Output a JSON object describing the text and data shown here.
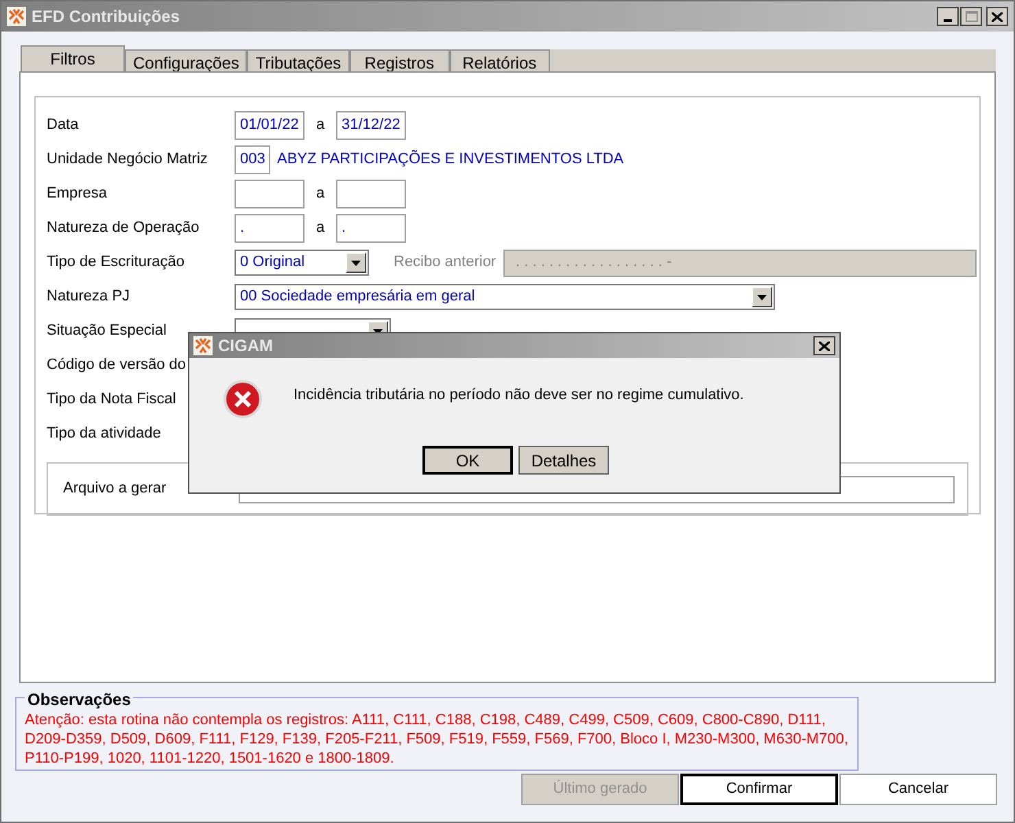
{
  "window": {
    "title": "EFD Contribuições"
  },
  "tabs": [
    {
      "label": "Filtros",
      "selected": true
    },
    {
      "label": "Configurações",
      "selected": false
    },
    {
      "label": "Tributações",
      "selected": false
    },
    {
      "label": "Registros",
      "selected": false
    },
    {
      "label": "Relatórios",
      "selected": false
    }
  ],
  "filters": [
    {
      "kind": "range",
      "label": "Data",
      "from": "01/01/22",
      "separator": "a",
      "to": "31/12/22"
    },
    {
      "kind": "code",
      "label": "Unidade Negócio Matriz",
      "code": "003",
      "description": "ABYZ PARTICIPAÇÕES E INVESTIMENTOS LTDA"
    },
    {
      "kind": "range",
      "label": "Empresa",
      "separator": "a"
    },
    {
      "kind": "range",
      "label": "Natureza de Operação",
      "from": ".",
      "separator": "a",
      "to": "."
    },
    {
      "kind": "combo_field",
      "label": "Tipo de Escrituração",
      "value": "0 Original",
      "field_label": "Recibo anterior",
      "field_value": ". . . . . . . . . . . . . . . . . . -"
    },
    {
      "kind": "combo_wide",
      "label": "Natureza PJ",
      "value": "00 Sociedade empresária em geral"
    },
    {
      "kind": "combo",
      "label": "Situação Especial"
    },
    {
      "kind": "label",
      "label": "Código de versão do"
    },
    {
      "kind": "label",
      "label": "Tipo da Nota Fiscal"
    },
    {
      "kind": "label",
      "label": "Tipo da atividade"
    }
  ],
  "output": {
    "label": "Arquivo a gerar"
  },
  "observations": {
    "title": "Observações",
    "text": "Atenção: esta rotina não contempla os registros: A111, C111, C188, C198, C489, C499, C509, C609, C800-C890, D111, D209-D359, D509, D609, F111, F129, F139, F205-F211, F509, F519, F559, F569, F700, Bloco I, M230-M300, M630-M700, P110-P199, 1020, 1101-1220, 1501-1620 e 1800-1809."
  },
  "buttons": [
    {
      "label": "Último gerado",
      "disabled": true,
      "default": false
    },
    {
      "label": "Confirmar",
      "disabled": false,
      "default": true
    },
    {
      "label": "Cancelar",
      "disabled": false,
      "default": false
    }
  ],
  "dialog": {
    "title": "CIGAM",
    "message": "Incidência tributária no período não deve ser no regime cumulativo.",
    "buttons": [
      {
        "label": "OK",
        "default": true
      },
      {
        "label": "Detalhes",
        "default": false
      }
    ]
  }
}
